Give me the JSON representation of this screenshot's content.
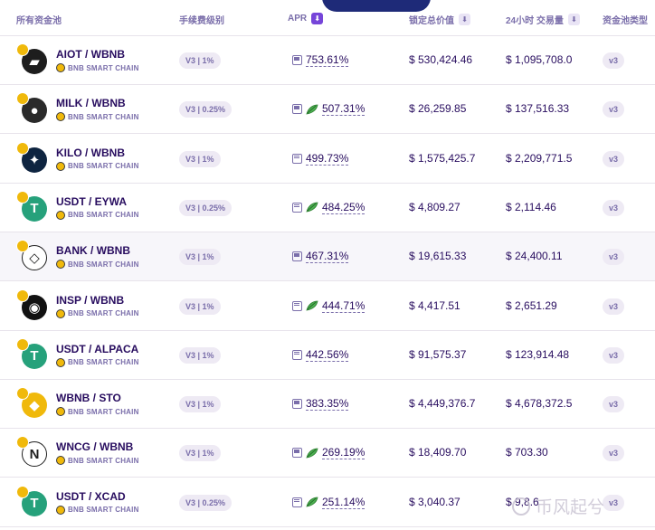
{
  "header": {
    "pool": "所有资金池",
    "fee": "手续费级别",
    "apr": "APR",
    "tvl": "锁定总价值",
    "volume": "24小时 交易量",
    "pool_type": "资金池类型"
  },
  "rows": [
    {
      "pair": "AIOT / WBNB",
      "chain": "BNB SMART CHAIN",
      "fee": "V3 | 1%",
      "apr": "753.61%",
      "farm": false,
      "tvl": "$ 530,424.46",
      "volume": "$ 1,095,708.0",
      "version": "v3",
      "color": "#1d1d1d",
      "glyph": "▰"
    },
    {
      "pair": "MILK / WBNB",
      "chain": "BNB SMART CHAIN",
      "fee": "V3 | 0.25%",
      "apr": "507.31%",
      "farm": true,
      "tvl": "$ 26,259.85",
      "volume": "$ 137,516.33",
      "version": "v3",
      "color": "#2a2a2a",
      "glyph": "●"
    },
    {
      "pair": "KILO / WBNB",
      "chain": "BNB SMART CHAIN",
      "fee": "V3 | 1%",
      "apr": "499.73%",
      "farm": false,
      "tvl": "$ 1,575,425.7",
      "volume": "$ 2,209,771.5",
      "version": "v3",
      "color": "#0e2440",
      "glyph": "✦"
    },
    {
      "pair": "USDT / EYWA",
      "chain": "BNB SMART CHAIN",
      "fee": "V3 | 0.25%",
      "apr": "484.25%",
      "farm": true,
      "tvl": "$ 4,809.27",
      "volume": "$ 2,114.46",
      "version": "v3",
      "color": "#26a17b",
      "glyph": "T"
    },
    {
      "pair": "BANK / WBNB",
      "chain": "BNB SMART CHAIN",
      "fee": "V3 | 1%",
      "apr": "467.31%",
      "farm": false,
      "tvl": "$ 19,615.33",
      "volume": "$ 24,400.11",
      "version": "v3",
      "color": "#ffffff",
      "glyph": "◇"
    },
    {
      "pair": "INSP / WBNB",
      "chain": "BNB SMART CHAIN",
      "fee": "V3 | 1%",
      "apr": "444.71%",
      "farm": true,
      "tvl": "$ 4,417.51",
      "volume": "$ 2,651.29",
      "version": "v3",
      "color": "#111111",
      "glyph": "◉"
    },
    {
      "pair": "USDT / ALPACA",
      "chain": "BNB SMART CHAIN",
      "fee": "V3 | 1%",
      "apr": "442.56%",
      "farm": false,
      "tvl": "$ 91,575.37",
      "volume": "$ 123,914.48",
      "version": "v3",
      "color": "#26a17b",
      "glyph": "T"
    },
    {
      "pair": "WBNB / STO",
      "chain": "BNB SMART CHAIN",
      "fee": "V3 | 1%",
      "apr": "383.35%",
      "farm": false,
      "tvl": "$ 4,449,376.7",
      "volume": "$ 4,678,372.5",
      "version": "v3",
      "color": "#f0b90b",
      "glyph": "◆"
    },
    {
      "pair": "WNCG / WBNB",
      "chain": "BNB SMART CHAIN",
      "fee": "V3 | 1%",
      "apr": "269.19%",
      "farm": true,
      "tvl": "$ 18,409.70",
      "volume": "$ 703.30",
      "version": "v3",
      "color": "#ffffff",
      "glyph": "N"
    },
    {
      "pair": "USDT / XCAD",
      "chain": "BNB SMART CHAIN",
      "fee": "V3 | 0.25%",
      "apr": "251.14%",
      "farm": true,
      "tvl": "$ 3,040.37",
      "volume": "$ 9,8.6",
      "version": "v3",
      "color": "#26a17b",
      "glyph": "T"
    }
  ],
  "watermark": "币风起兮",
  "colors": {
    "accent": "#7645d9",
    "text": "#280d5f",
    "muted": "#7a6eaa",
    "bnb": "#f0b90b"
  }
}
